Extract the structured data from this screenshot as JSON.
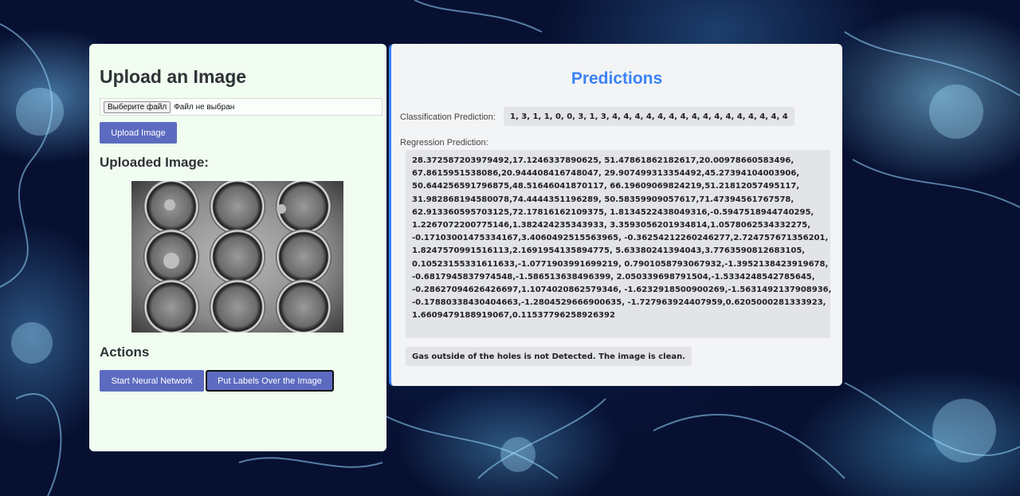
{
  "upload": {
    "title": "Upload an Image",
    "file_button_label": "Выберите файл",
    "file_status": "Файл не выбран",
    "upload_button_label": "Upload Image",
    "uploaded_heading": "Uploaded Image:",
    "actions_heading": "Actions",
    "start_button_label": "Start Neural Network",
    "labels_button_label": "Put Labels Over the Image"
  },
  "predictions": {
    "title": "Predictions",
    "classification_label": "Classification Prediction:",
    "classification_value": "1, 3, 1, 1, 0, 0, 3, 1, 3, 4, 4, 4, 4, 4, 4, 4, 4, 4, 4, 4, 4, 4, 4, 4, 4",
    "regression_label": "Regression Prediction:",
    "regression_lines": [
      "28.372587203979492,17.1246337890625, 51.47861862182617,20.00978660583496,",
      "67.8615951538086,20.944408416748047, 29.907499313354492,45.27394104003906,",
      "50.644256591796875,48.51646041870117, 66.19609069824219,51.21812057495117,",
      "31.982868194580078,74.4444351196289, 50.58359909057617,71.47394561767578,",
      "62.913360595703125,72.17816162109375, 1.8134522438049316,-0.5947518944740295,",
      "1.2267072200775146,1.382424235343933, 3.3593056201934814,1.0578062534332275,",
      "-0.17103001475334167,3.4060492515563965, -0.36254212260246277,2.724757671356201,",
      "1.8247570991516113,2.1691954135894775, 5.63380241394043,3.7763590812683105,",
      "0.10523155331611633,-1.0771903991699219, 0.7901058793067932,-1.3952138423919678,",
      "-0.6817945837974548,-1.586513638496399, 2.050339698791504,-1.5334248542785645,",
      "-0.28627094626426697,1.1074020862579346, -1.6232918500900269,-1.5631492137908936,",
      "-0.17880338430404663,-1.2804529666900635, -1.727963924407959,0.6205000281333923,",
      "1.6609479188919067,0.11537796258926392"
    ],
    "gas_status": "Gas outside of the holes is not Detected. The image is clean."
  }
}
